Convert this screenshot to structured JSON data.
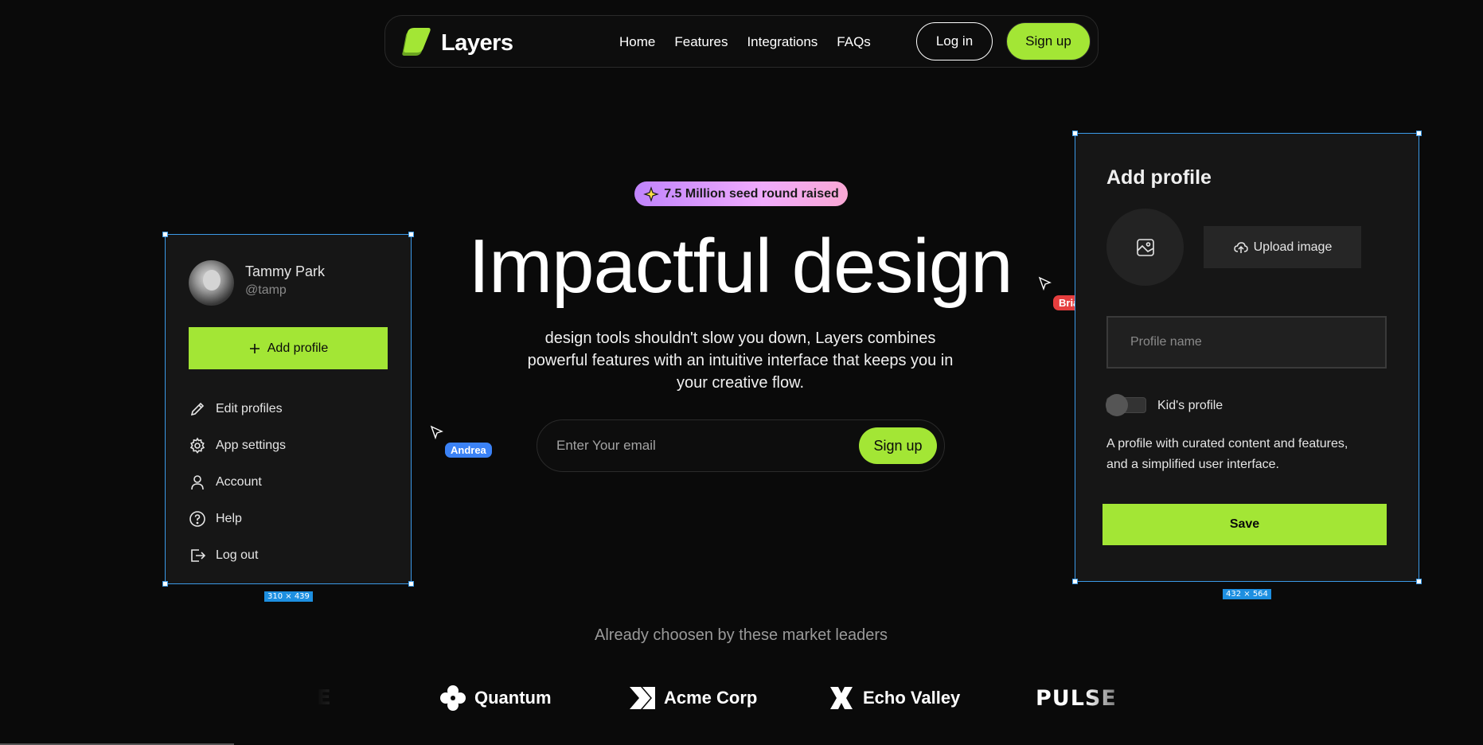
{
  "nav": {
    "brand": "Layers",
    "links": [
      "Home",
      "Features",
      "Integrations",
      "FAQs"
    ],
    "login_label": "Log in",
    "signup_label": "Sign up"
  },
  "badge": {
    "text": "7.5 Million seed round raised"
  },
  "hero": {
    "title": "Impactful design",
    "subtitle": "design tools shouldn't slow you down, Layers combines powerful features with an intuitive interface that keeps you in your creative flow.",
    "email_placeholder": "Enter Your email",
    "signup_label": "Sign up"
  },
  "profile_menu": {
    "name": "Tammy Park",
    "handle": "@tamp",
    "add_profile_label": "Add profile",
    "items": [
      {
        "label": "Edit profiles",
        "icon": "pencil-icon"
      },
      {
        "label": "App settings",
        "icon": "gear-icon"
      },
      {
        "label": "Account",
        "icon": "user-icon"
      },
      {
        "label": "Help",
        "icon": "help-icon"
      },
      {
        "label": "Log out",
        "icon": "logout-icon"
      }
    ],
    "dimensions": "310 × 439"
  },
  "add_profile_card": {
    "title": "Add profile",
    "upload_label": "Upload image",
    "name_placeholder": "Profile name",
    "kids_label": "Kid's profile",
    "kids_description": "A profile with curated content and features, and a simplified user interface.",
    "save_label": "Save",
    "dimensions": "432 × 564"
  },
  "cursors": [
    {
      "name": "Andrea",
      "color": "#3b82f6"
    },
    {
      "name": "Brian",
      "color": "#e53e3e"
    }
  ],
  "leaders": {
    "text": "Already choosen by these market leaders",
    "logos": [
      "Quantum",
      "Acme Corp",
      "Echo Valley",
      "PULSE"
    ]
  },
  "colors": {
    "accent": "#a3e635",
    "background": "#0a0a0a",
    "card": "#161616",
    "selection": "#3b9ae8"
  }
}
